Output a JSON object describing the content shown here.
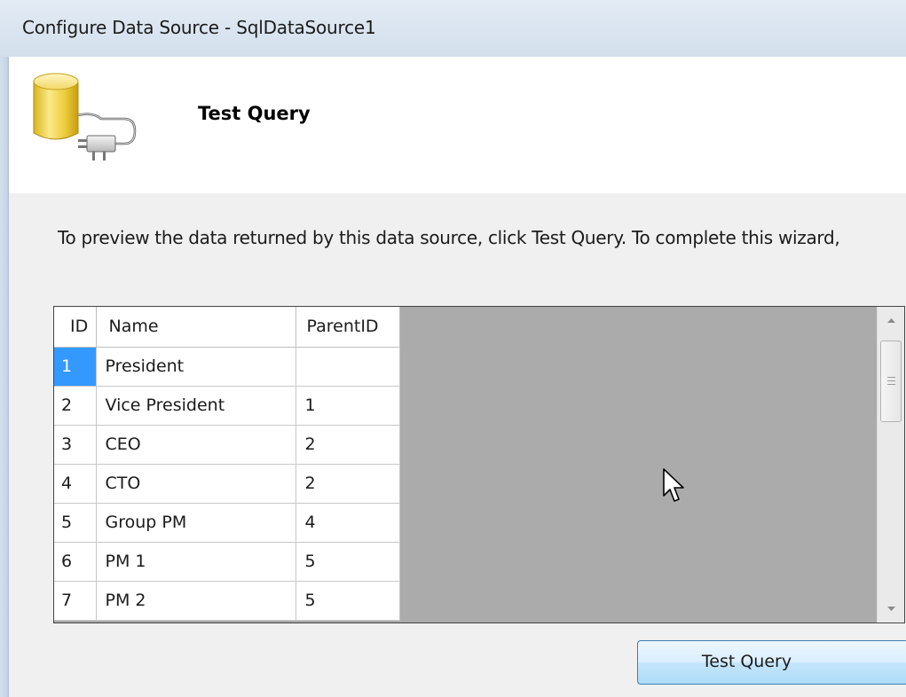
{
  "window": {
    "title": "Configure Data Source - SqlDataSource1"
  },
  "header": {
    "title": "Test Query",
    "icon": "database-plug-icon"
  },
  "instructions": "To preview the data returned by this data source, click Test Query. To complete this wizard,",
  "grid": {
    "columns": [
      "ID",
      "Name",
      "ParentID"
    ],
    "rows": [
      [
        "1",
        "President",
        ""
      ],
      [
        "2",
        "Vice President",
        "1"
      ],
      [
        "3",
        "CEO",
        "2"
      ],
      [
        "4",
        "CTO",
        "2"
      ],
      [
        "5",
        "Group PM",
        "4"
      ],
      [
        "6",
        "PM 1",
        "5"
      ],
      [
        "7",
        "PM 2",
        "5"
      ]
    ],
    "selected_cell": "1"
  },
  "buttons": {
    "test_query": "Test Query"
  },
  "colors": {
    "selection": "#3399ff",
    "titlebar": "#dbe6f1",
    "content_bg": "#f0f0f0",
    "grid_empty": "#ababab"
  }
}
